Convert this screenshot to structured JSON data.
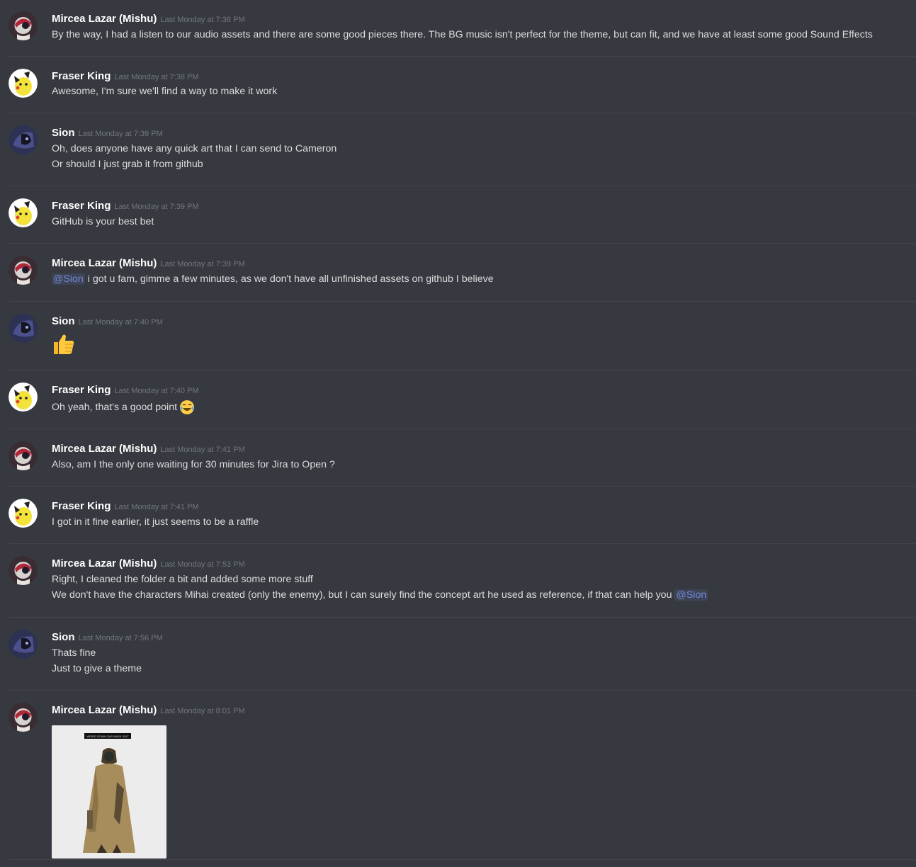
{
  "messages": [
    {
      "author": "Mircea Lazar (Mishu)",
      "timestamp": "Last Monday at 7:38 PM",
      "lines": [
        "By the way, I had a listen to our audio assets and there are some good pieces there. The BG music isn't perfect for the theme, but can fit, and we have at least some good Sound Effects"
      ]
    },
    {
      "author": "Fraser King",
      "timestamp": "Last Monday at 7:38 PM",
      "lines": [
        "Awesome, I'm sure we'll find a way to make it work"
      ]
    },
    {
      "author": "Sion",
      "timestamp": "Last Monday at 7:39 PM",
      "lines": [
        "Oh, does anyone have any quick art that I can send to Cameron",
        "Or should I just grab it from github"
      ]
    },
    {
      "author": "Fraser King",
      "timestamp": "Last Monday at 7:39 PM",
      "lines": [
        "GitHub is your best bet"
      ]
    },
    {
      "author": "Mircea Lazar (Mishu)",
      "timestamp": "Last Monday at 7:39 PM",
      "mention": "@Sion",
      "lines": [
        "i got u fam, gimme a few minutes, as we don't have all unfinished assets on github I believe"
      ]
    },
    {
      "author": "Sion",
      "timestamp": "Last Monday at 7:40 PM",
      "emoji": "thumbs-up"
    },
    {
      "author": "Fraser King",
      "timestamp": "Last Monday at 7:40 PM",
      "lines": [
        "Oh yeah, that's a good point"
      ],
      "emoji": "joy"
    },
    {
      "author": "Mircea Lazar (Mishu)",
      "timestamp": "Last Monday at 7:41 PM",
      "lines": [
        "Also, am I the only one waiting for 30 minutes for Jira to Open ?"
      ]
    },
    {
      "author": "Fraser King",
      "timestamp": "Last Monday at 7:41 PM",
      "lines": [
        "I got in it fine earlier, it just seems to be a raffle"
      ]
    },
    {
      "author": "Mircea Lazar (Mishu)",
      "timestamp": "Last Monday at 7:53 PM",
      "lines": [
        "Right, I cleaned the folder a bit and added some more stuff",
        "We don't have the characters Mihai created (only the enemy), but I can surely find the concept art he used as reference, if that can help you"
      ],
      "mention_end": "@Sion"
    },
    {
      "author": "Sion",
      "timestamp": "Last Monday at 7:56 PM",
      "lines": [
        "Thats fine",
        "Just to give a theme"
      ]
    },
    {
      "author": "Mircea Lazar (Mishu)",
      "timestamp": "Last Monday at 8:01 PM",
      "attachment_caption": "WEIRD DOWN GAS MASK SUIT"
    }
  ],
  "colors": {
    "background": "#36393f",
    "username": "#ffffff",
    "timestamp": "#72767d",
    "text": "#dcddde",
    "mention": "#7289da"
  }
}
